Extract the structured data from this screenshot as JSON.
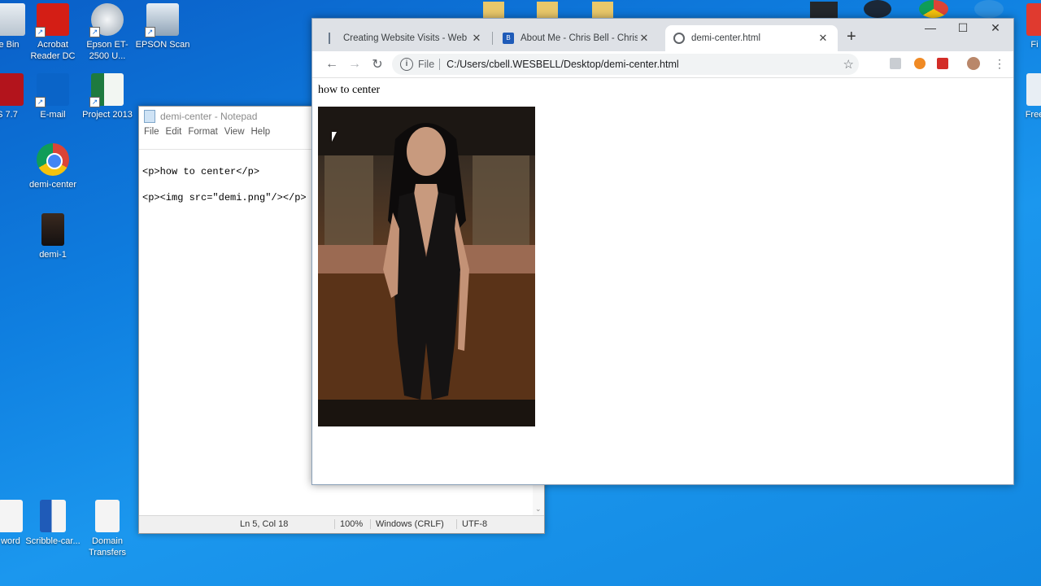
{
  "desktop": {
    "icons": [
      {
        "label": "e Bin"
      },
      {
        "label": "Acrobat Reader DC"
      },
      {
        "label": "Epson ET-2500 U..."
      },
      {
        "label": "EPSON Scan"
      },
      {
        "label": "S 7.7"
      },
      {
        "label": "E-mail"
      },
      {
        "label": "Project 2013"
      },
      {
        "label": "demi-center"
      },
      {
        "label": "demi-1"
      },
      {
        "label": "word"
      },
      {
        "label": "Scribble-car..."
      },
      {
        "label": "Domain Transfers"
      },
      {
        "label": "Fi"
      },
      {
        "label": "Free"
      }
    ]
  },
  "notepad": {
    "title": "demi-center - Notepad",
    "menu": [
      "File",
      "Edit",
      "Format",
      "View",
      "Help"
    ],
    "lines": [
      "<p>how to center</p>",
      "<p><img src=\"demi.png\"/></p>"
    ],
    "status": {
      "position": "Ln 5, Col 18",
      "zoom": "100%",
      "line_endings": "Windows (CRLF)",
      "encoding": "UTF-8"
    }
  },
  "browser": {
    "tabs": [
      {
        "title": "Creating Website Visits - Web De",
        "active": false
      },
      {
        "title": "About Me - Chris Bell - Christoph",
        "active": false
      },
      {
        "title": "demi-center.html",
        "active": true
      }
    ],
    "new_tab": "+",
    "window_controls": {
      "minimize": "—",
      "maximize": "☐",
      "close": "✕"
    },
    "nav": {
      "back": "←",
      "forward": "→",
      "reload": "↻"
    },
    "address": {
      "scheme": "File",
      "url": "C:/Users/cbell.WESBELL/Desktop/demi-center.html"
    },
    "page": {
      "text": "how to center"
    }
  },
  "colors": {
    "desktop": "#0f7fe0",
    "chrome_tabstrip": "#dee1e6",
    "omnibox": "#f1f3f4"
  }
}
